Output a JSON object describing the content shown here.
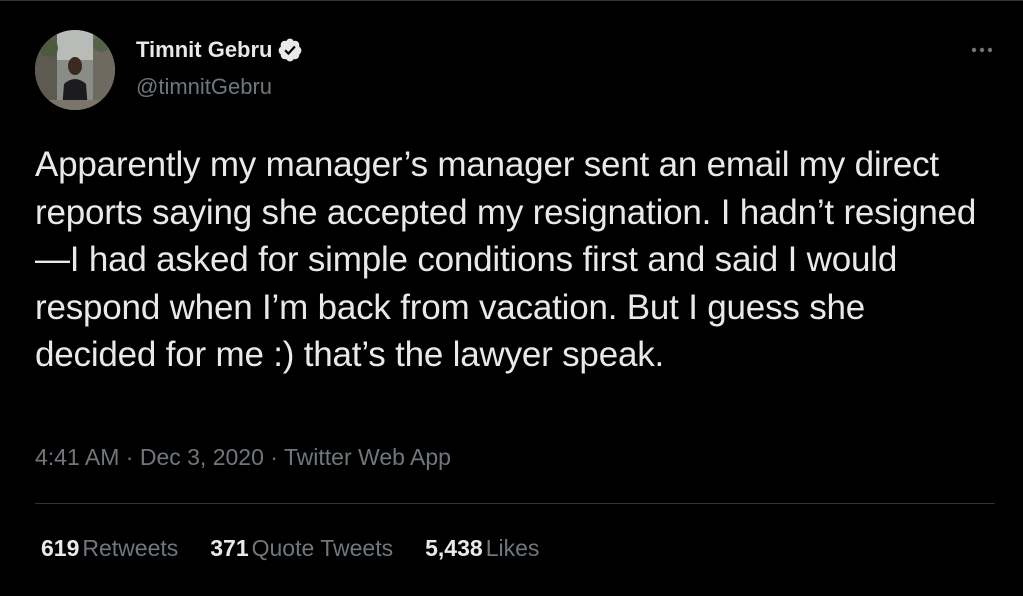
{
  "author": {
    "display_name": "Timnit Gebru",
    "handle": "@timnitGebru",
    "verified": true,
    "verified_icon": "verified-badge-icon",
    "avatar_icon": "profile-photo"
  },
  "more_icon": "more-horizontal-icon",
  "tweet": {
    "text": "Apparently my manager’s manager sent an email my direct reports saying she accepted my resignation. I hadn’t resigned—I had asked for simple conditions first and said I would respond when I’m back from vacation. But I guess she decided for me :) that’s the lawyer speak."
  },
  "meta": {
    "time": "4:41 AM",
    "separator": " · ",
    "date": "Dec 3, 2020",
    "source": "Twitter Web App"
  },
  "stats": {
    "retweets_count": "619",
    "retweets_label": "Retweets",
    "quote_tweets_count": "371",
    "quote_tweets_label": "Quote Tweets",
    "likes_count": "5,438",
    "likes_label": "Likes"
  },
  "colors": {
    "background": "#000000",
    "primary_text": "#e7e9ea",
    "secondary_text": "#71767b",
    "divider": "#2f3336"
  }
}
